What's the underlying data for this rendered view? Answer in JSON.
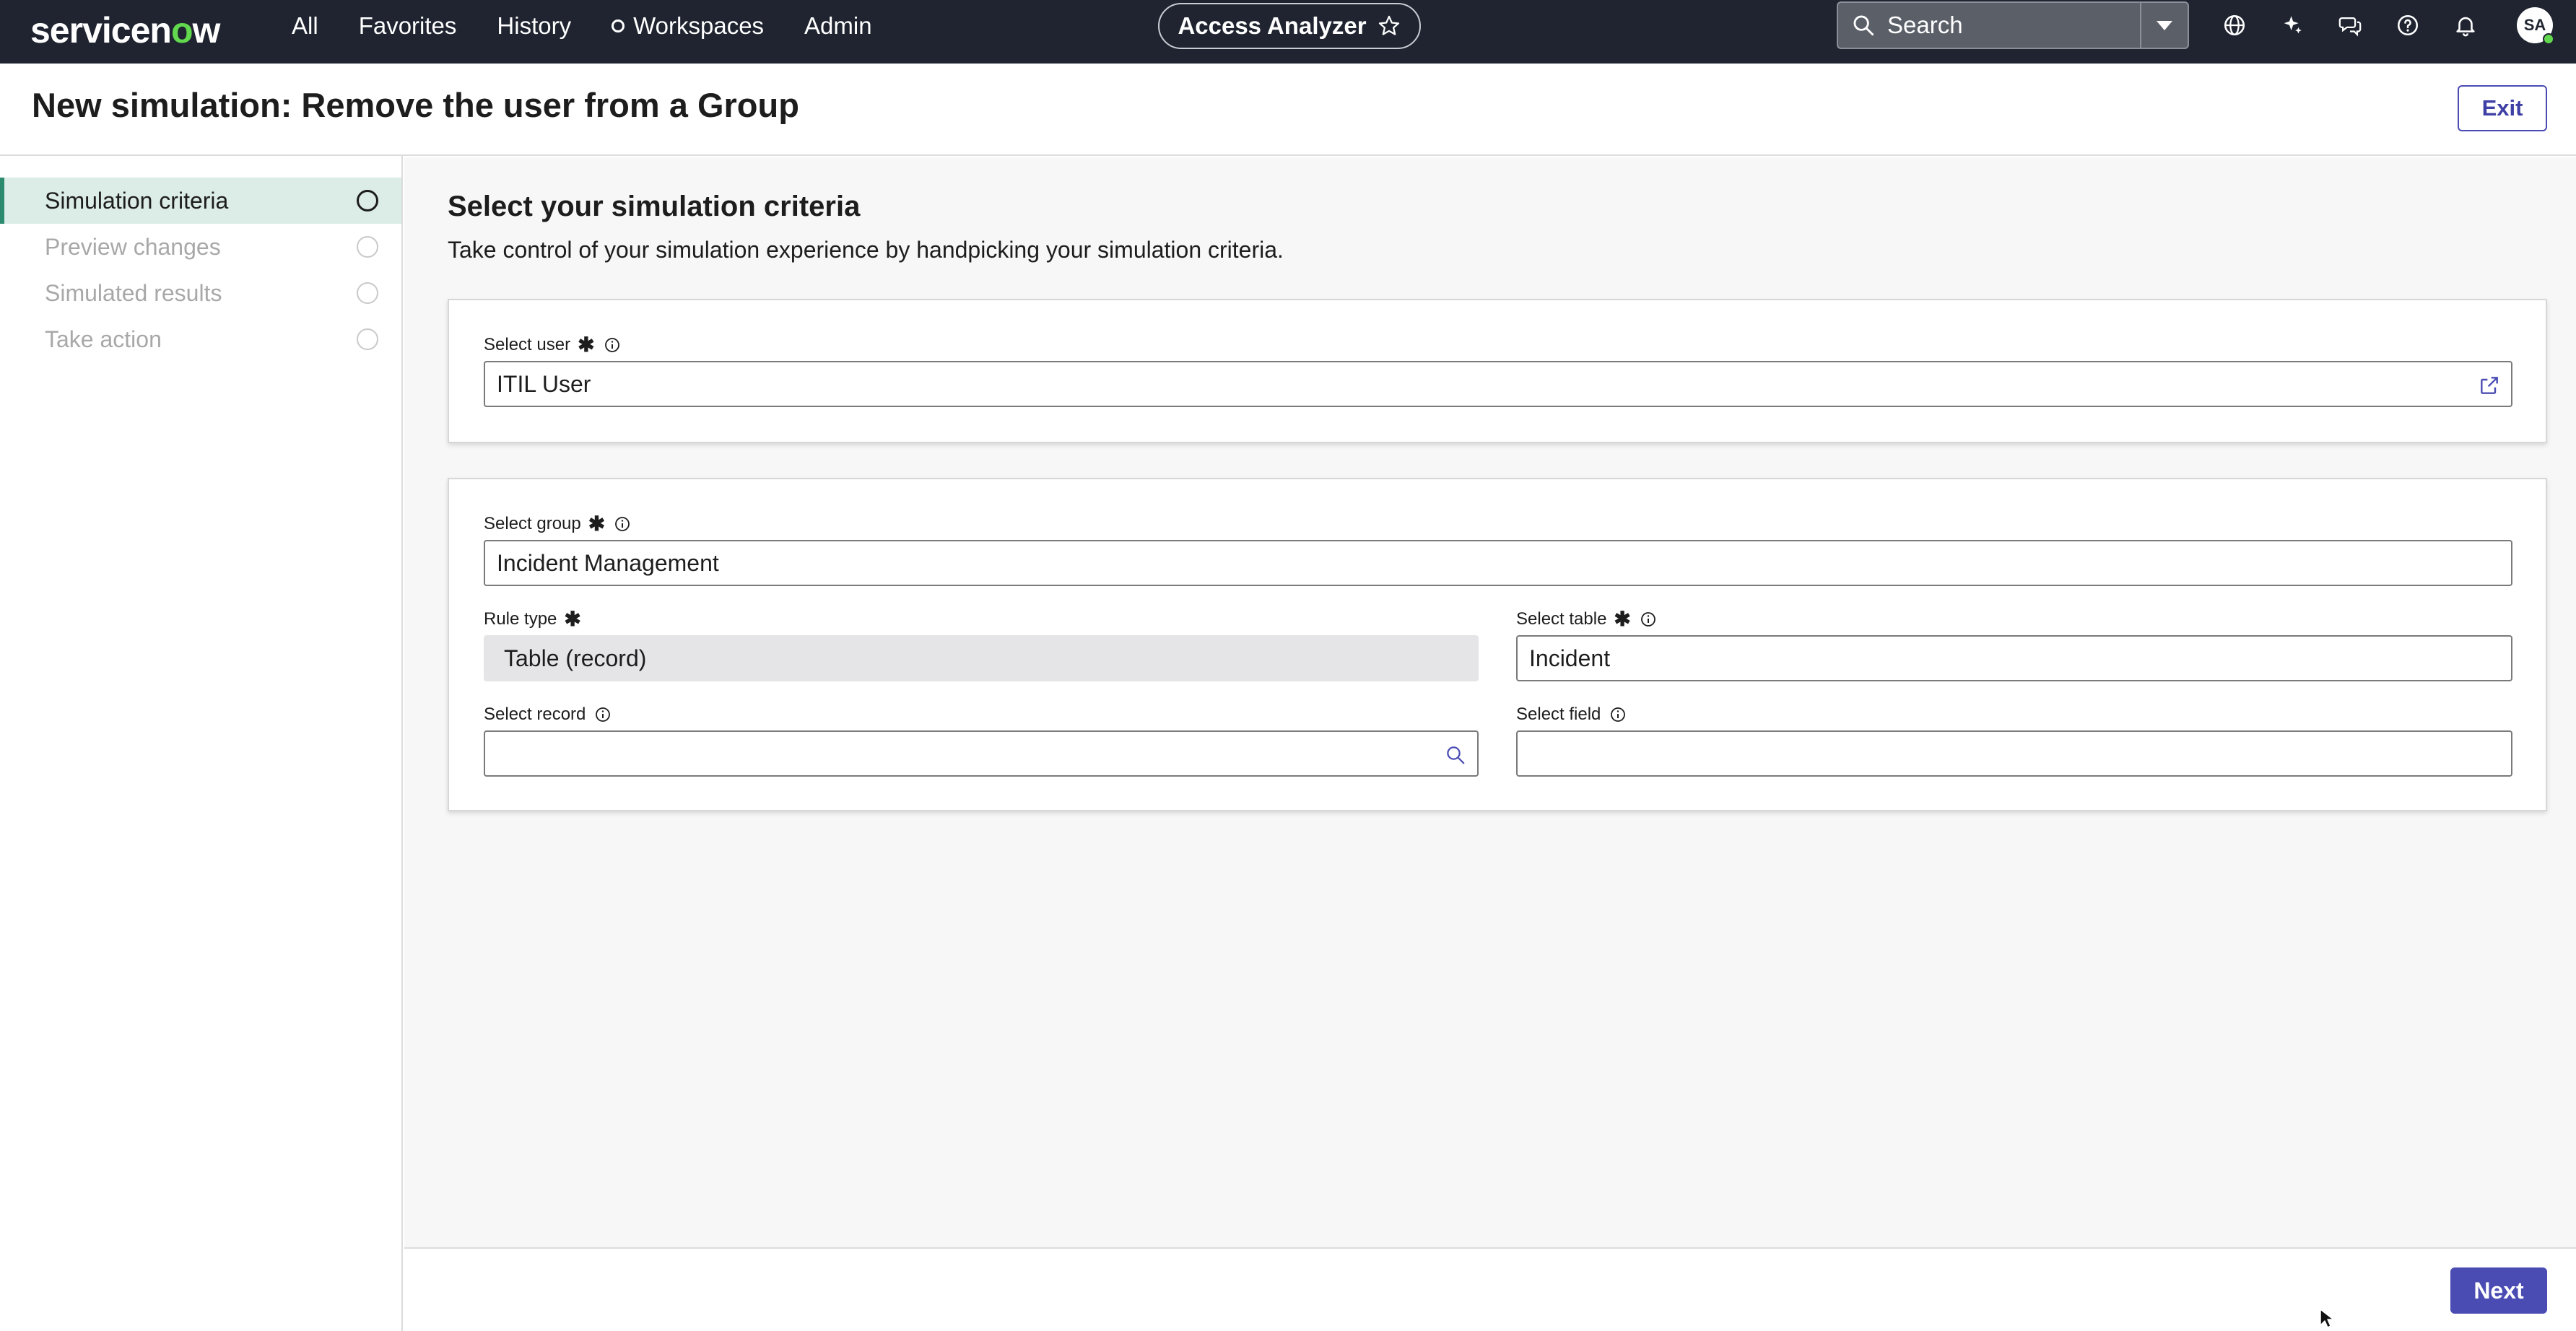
{
  "nav": {
    "brand": "servicenow",
    "links": [
      "All",
      "Favorites",
      "History",
      "Workspaces",
      "Admin"
    ],
    "app_pill": "Access Analyzer",
    "search_placeholder": "Search",
    "avatar_initials": "SA",
    "icons": [
      "globe-icon",
      "sparkle-icon",
      "chat-icon",
      "help-icon",
      "bell-icon"
    ]
  },
  "page": {
    "title": "New simulation: Remove the user from a Group",
    "exit_label": "Exit"
  },
  "steps": [
    {
      "label": "Simulation criteria",
      "state": "active"
    },
    {
      "label": "Preview changes",
      "state": "inactive"
    },
    {
      "label": "Simulated results",
      "state": "inactive"
    },
    {
      "label": "Take action",
      "state": "inactive"
    }
  ],
  "section": {
    "title": "Select your simulation criteria",
    "subtitle": "Take control of your simulation experience by handpicking your simulation criteria."
  },
  "fields": {
    "user": {
      "label": "Select user",
      "required": "✱",
      "value": "ITIL User"
    },
    "group": {
      "label": "Select group",
      "required": "✱",
      "value": "Incident Management"
    },
    "rule_type": {
      "label": "Rule type",
      "required": "✱",
      "value": "Table (record)"
    },
    "table": {
      "label": "Select table",
      "required": "✱",
      "value": "Incident"
    },
    "record": {
      "label": "Select record",
      "value": ""
    },
    "field": {
      "label": "Select field",
      "value": ""
    }
  },
  "footer": {
    "next_label": "Next"
  },
  "colors": {
    "nav_bg": "#1f2430",
    "brand_green": "#62d84e",
    "primary": "#4a4cb3",
    "active_step_bg": "#dcece6",
    "active_step_bar": "#2c8b6f"
  }
}
